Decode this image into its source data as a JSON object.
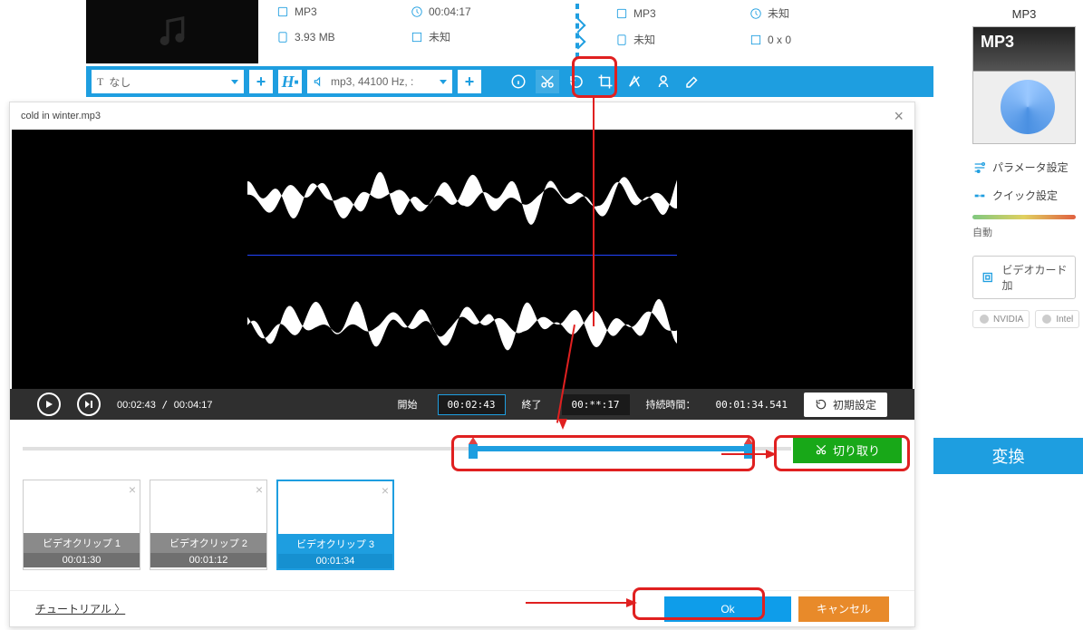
{
  "file_info": {
    "left": {
      "format": "MP3",
      "duration": "00:04:17",
      "size": "3.93 MB",
      "resolution": "未知"
    },
    "right": {
      "format": "MP3",
      "duration": "未知",
      "size": "未知",
      "resolution": "0 x 0"
    }
  },
  "toolbar": {
    "subtitle_label": "なし",
    "audio_label": "mp3, 44100 Hz, :"
  },
  "dialog": {
    "title": "cold in winter.mp3",
    "current_time": "00:02:43",
    "total_time": "00:04:17",
    "start_label": "開始",
    "start_value": "00:02:43",
    "end_label": "終了",
    "end_value": "00:**:17",
    "duration_label": "持続時間：",
    "duration_value": "00:01:34.541",
    "reset_label": "初期設定",
    "cut_label": "切り取り",
    "tutorial": "チュートリアル 〉",
    "ok": "Ok",
    "cancel": "キャンセル"
  },
  "clips": [
    {
      "label": "ビデオクリップ 1",
      "time": "00:01:30"
    },
    {
      "label": "ビデオクリップ 2",
      "time": "00:01:12"
    },
    {
      "label": "ビデオクリップ 3",
      "time": "00:01:34"
    }
  ],
  "side": {
    "format": "MP3",
    "thumb_label": "MP3",
    "param": "パラメータ設定",
    "quick": "クイック設定",
    "slider_label": "自動",
    "videocard": "ビデオカード加",
    "nvidia": "NVIDIA",
    "intel": "Intel"
  },
  "convert": "変換"
}
